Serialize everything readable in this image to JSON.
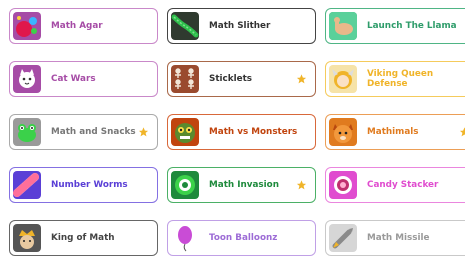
{
  "games": [
    {
      "key": "math-agar",
      "title": "Math Agar",
      "color": "#a64ca6",
      "border": "#c988c9",
      "featured": false,
      "icon": "colored-blobs-icon"
    },
    {
      "key": "math-slither",
      "title": "Math Slither",
      "color": "#333333",
      "border": "#444444",
      "featured": false,
      "icon": "green-snake-icon"
    },
    {
      "key": "launch-the-llama",
      "title": "Launch The Llama",
      "color": "#2e9c6a",
      "border": "#4fb585",
      "featured": false,
      "icon": "llama-icon"
    },
    {
      "key": "cat-wars",
      "title": "Cat Wars",
      "color": "#a64ca6",
      "border": "#c988c9",
      "featured": false,
      "icon": "cat-icon"
    },
    {
      "key": "sticklets",
      "title": "Sticklets",
      "color": "#333333",
      "border": "#a9694a",
      "featured": true,
      "icon": "stick-figures-icon"
    },
    {
      "key": "viking-queen-defense",
      "title": "Viking Queen Defense",
      "color": "#f0b429",
      "border": "#f5cb5c",
      "featured": false,
      "icon": "viking-queen-icon"
    },
    {
      "key": "math-and-snacks",
      "title": "Math and Snacks",
      "color": "#777777",
      "border": "#aaaaaa",
      "featured": true,
      "icon": "green-frog-icon"
    },
    {
      "key": "math-vs-monsters",
      "title": "Math vs Monsters",
      "color": "#c1440e",
      "border": "#d8683a",
      "featured": false,
      "icon": "monster-icon"
    },
    {
      "key": "mathimals",
      "title": "Mathimals",
      "color": "#e07b1f",
      "border": "#ec9e56",
      "featured": true,
      "icon": "fox-icon"
    },
    {
      "key": "number-worms",
      "title": "Number Worms",
      "color": "#5a3fd6",
      "border": "#8470e2",
      "featured": false,
      "icon": "worm-icon"
    },
    {
      "key": "math-invasion",
      "title": "Math Invasion",
      "color": "#1e8a3c",
      "border": "#4bb066",
      "featured": true,
      "icon": "green-alien-icon"
    },
    {
      "key": "candy-stacker",
      "title": "Candy Stacker",
      "color": "#e04ccf",
      "border": "#ea86de",
      "featured": false,
      "icon": "candy-icon"
    },
    {
      "key": "king-of-math",
      "title": "King of Math",
      "color": "#444444",
      "border": "#666666",
      "featured": false,
      "icon": "king-icon"
    },
    {
      "key": "toon-balloonz",
      "title": "Toon Balloonz",
      "color": "#9d6cd6",
      "border": "#c0a0e6",
      "featured": false,
      "icon": "balloon-icon"
    },
    {
      "key": "math-missile",
      "title": "Math Missile",
      "color": "#999999",
      "border": "#c9c9c9",
      "featured": false,
      "icon": "missile-icon"
    }
  ],
  "star_color": "#f0b429"
}
